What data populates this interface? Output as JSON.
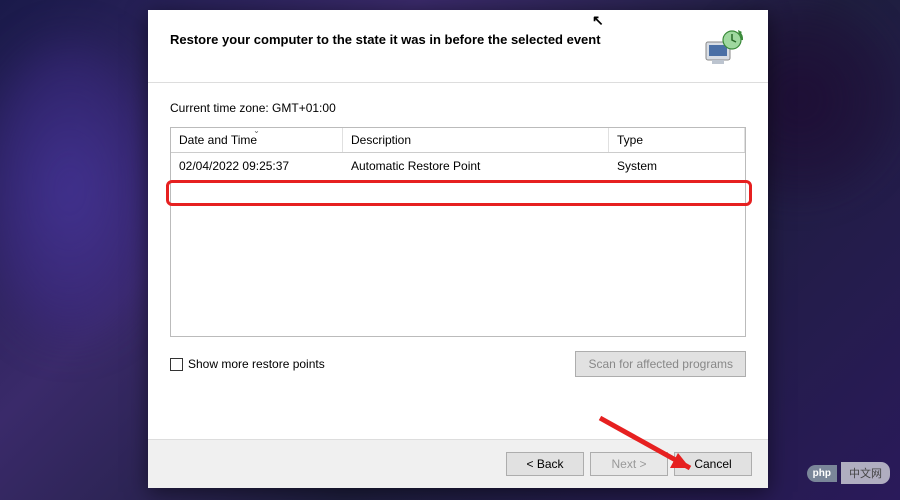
{
  "header": {
    "title": "Restore your computer to the state it was in before the selected event"
  },
  "body": {
    "timezone_label": "Current time zone: GMT+01:00",
    "columns": {
      "date": "Date and Time",
      "description": "Description",
      "type": "Type"
    },
    "rows": [
      {
        "date": "02/04/2022 09:25:37",
        "description": "Automatic Restore Point",
        "type": "System"
      }
    ],
    "checkbox_label": "Show more restore points",
    "scan_button": "Scan for affected programs"
  },
  "footer": {
    "back": "< Back",
    "next": "Next >",
    "cancel": "Cancel"
  },
  "watermark": {
    "badge": "php",
    "text": "中文网"
  }
}
